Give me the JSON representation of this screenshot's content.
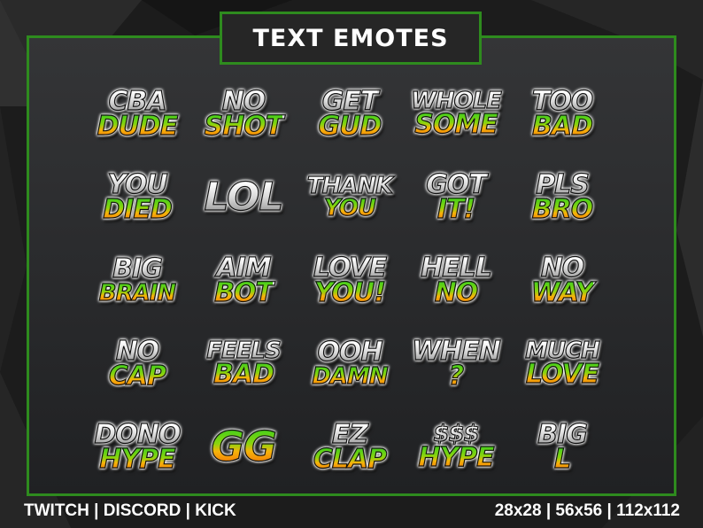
{
  "title": "TEXT EMOTES",
  "footer": {
    "platforms": "TWITCH | DISCORD | KICK",
    "sizes": "28x28  | 56x56 | 112x112"
  },
  "emotes": [
    {
      "top": "CBA",
      "bottom": "DUDE"
    },
    {
      "top": "NO",
      "bottom": "SHOT"
    },
    {
      "top": "GET",
      "bottom": "GUD"
    },
    {
      "top": "WHOLE",
      "bottom": "SOME"
    },
    {
      "top": "TOO",
      "bottom": "BAD"
    },
    {
      "top": "YOU",
      "bottom": "DIED"
    },
    {
      "top": "LOL",
      "bottom": ""
    },
    {
      "top": "THANK",
      "bottom": "YOU"
    },
    {
      "top": "GOT",
      "bottom": "IT!"
    },
    {
      "top": "PLS",
      "bottom": "BRO"
    },
    {
      "top": "BIG",
      "bottom": "BRAIN"
    },
    {
      "top": "AIM",
      "bottom": "BOT"
    },
    {
      "top": "LOVE",
      "bottom": "YOU!"
    },
    {
      "top": "HELL",
      "bottom": "NO"
    },
    {
      "top": "NO",
      "bottom": "WAY"
    },
    {
      "top": "NO",
      "bottom": "CAP"
    },
    {
      "top": "FEELS",
      "bottom": "BAD"
    },
    {
      "top": "OOH",
      "bottom": "DAMN"
    },
    {
      "top": "WHEN",
      "bottom": "?"
    },
    {
      "top": "MUCH",
      "bottom": "LOVE"
    },
    {
      "top": "DONO",
      "bottom": "HYPE"
    },
    {
      "top": "",
      "bottom": "GG"
    },
    {
      "top": "EZ",
      "bottom": "CLAP"
    },
    {
      "top": "$$$",
      "bottom": "HYPE"
    },
    {
      "top": "BIG",
      "bottom": "L"
    }
  ],
  "colors": {
    "accent_green": "#2e8b1e",
    "panel": "#2a2b2d",
    "background": "#1c1c1c"
  }
}
